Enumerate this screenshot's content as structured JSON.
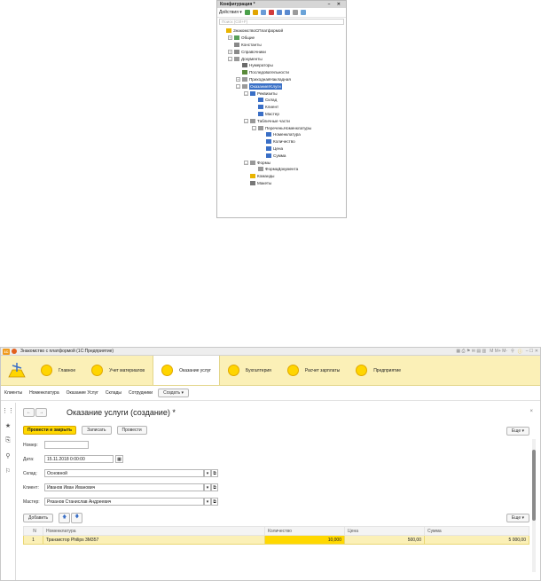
{
  "configurator": {
    "title": "Конфигурация *",
    "window_controls": "– ✕",
    "actions_label": "Действия ▾",
    "search_placeholder": "Поиск (Ctrl+F)",
    "tree": [
      {
        "label": "ЗнакомствоСПлатформой",
        "level": 0,
        "exp": "",
        "icon": "config-icon",
        "color": "#e9b400"
      },
      {
        "label": "Общие",
        "level": 1,
        "exp": "+",
        "icon": "common-icon",
        "color": "#5aa05a"
      },
      {
        "label": "Константы",
        "level": 1,
        "exp": "",
        "icon": "constants-icon",
        "color": "#888"
      },
      {
        "label": "Справочники",
        "level": 1,
        "exp": "+",
        "icon": "catalogs-icon",
        "color": "#8a8a8a"
      },
      {
        "label": "Документы",
        "level": 1,
        "exp": "–",
        "icon": "documents-icon",
        "color": "#999"
      },
      {
        "label": "Нумераторы",
        "level": 2,
        "exp": "",
        "icon": "numerator-icon",
        "color": "#6a6a6a"
      },
      {
        "label": "Последовательности",
        "level": 2,
        "exp": "",
        "icon": "sequence-icon",
        "color": "#5a8a3a"
      },
      {
        "label": "ПриходнаяНакладная",
        "level": 2,
        "exp": "+",
        "icon": "document-icon",
        "color": "#999"
      },
      {
        "label": "ОказаниеУслуги",
        "level": 2,
        "exp": "–",
        "icon": "document-icon",
        "color": "#999",
        "selected": true
      },
      {
        "label": "Реквизиты",
        "level": 3,
        "exp": "–",
        "icon": "attributes-icon",
        "color": "#3a6fc6"
      },
      {
        "label": "Склад",
        "level": 4,
        "exp": "",
        "icon": "attribute-icon",
        "color": "#3a6fc6"
      },
      {
        "label": "Клиент",
        "level": 4,
        "exp": "",
        "icon": "attribute-icon",
        "color": "#3a6fc6"
      },
      {
        "label": "Мастер",
        "level": 4,
        "exp": "",
        "icon": "attribute-icon",
        "color": "#3a6fc6"
      },
      {
        "label": "Табличные части",
        "level": 3,
        "exp": "–",
        "icon": "tabular-icon",
        "color": "#999"
      },
      {
        "label": "ПереченьНоменклатуры",
        "level": 4,
        "exp": "–",
        "icon": "tabular-icon",
        "color": "#999"
      },
      {
        "label": "Номенклатура",
        "level": 5,
        "exp": "",
        "icon": "attribute-icon",
        "color": "#3a6fc6"
      },
      {
        "label": "Количество",
        "level": 5,
        "exp": "",
        "icon": "attribute-icon",
        "color": "#3a6fc6"
      },
      {
        "label": "Цена",
        "level": 5,
        "exp": "",
        "icon": "attribute-icon",
        "color": "#3a6fc6"
      },
      {
        "label": "Сумма",
        "level": 5,
        "exp": "",
        "icon": "attribute-icon",
        "color": "#3a6fc6"
      },
      {
        "label": "Формы",
        "level": 3,
        "exp": "–",
        "icon": "forms-icon",
        "color": "#999"
      },
      {
        "label": "ФормаДокумента",
        "level": 4,
        "exp": "",
        "icon": "form-icon",
        "color": "#999"
      },
      {
        "label": "Команды",
        "level": 3,
        "exp": "",
        "icon": "commands-icon",
        "color": "#e9b400"
      },
      {
        "label": "Макеты",
        "level": 3,
        "exp": "",
        "icon": "templates-icon",
        "color": "#777"
      }
    ]
  },
  "app": {
    "title": "Знакомство с платформой (1С:Предприятие)",
    "window_controls": "– ☐ ✕",
    "toolbar_text": "M M+ M-",
    "sections": [
      "Главное",
      "Учет материалов",
      "Оказание услуг",
      "Бухгалтерия",
      "Расчет зарплаты",
      "Предприятие"
    ],
    "nav_links": [
      "Клиенты",
      "Номенклатура",
      "Оказание Услуг",
      "Склады",
      "Сотрудники"
    ],
    "create_label": "Создать ▾"
  },
  "form": {
    "title": "Оказание услуги (создание) *",
    "post_close": "Провести и закрыть",
    "write": "Записать",
    "post": "Провести",
    "more": "Еще ▾",
    "number_label": "Номер:",
    "number_value": "",
    "date_label": "Дата:",
    "date_value": "15.11.2018  0:00:00",
    "warehouse_label": "Склад:",
    "warehouse_value": "Основной",
    "client_label": "Клиент:",
    "client_value": "Иванов Иван Иванович",
    "master_label": "Мастер:",
    "master_value": "Рязанов Станислав Андреевич",
    "add": "Добавить",
    "table_more": "Еще ▾",
    "columns": [
      "N",
      "Номенклатура",
      "Количество",
      "Цена",
      "Сумма"
    ],
    "rows": [
      {
        "n": "1",
        "item": "Транзистор Philips 3M357",
        "qty": "10,000",
        "price": "500,00",
        "sum": "5 000,00"
      }
    ]
  }
}
